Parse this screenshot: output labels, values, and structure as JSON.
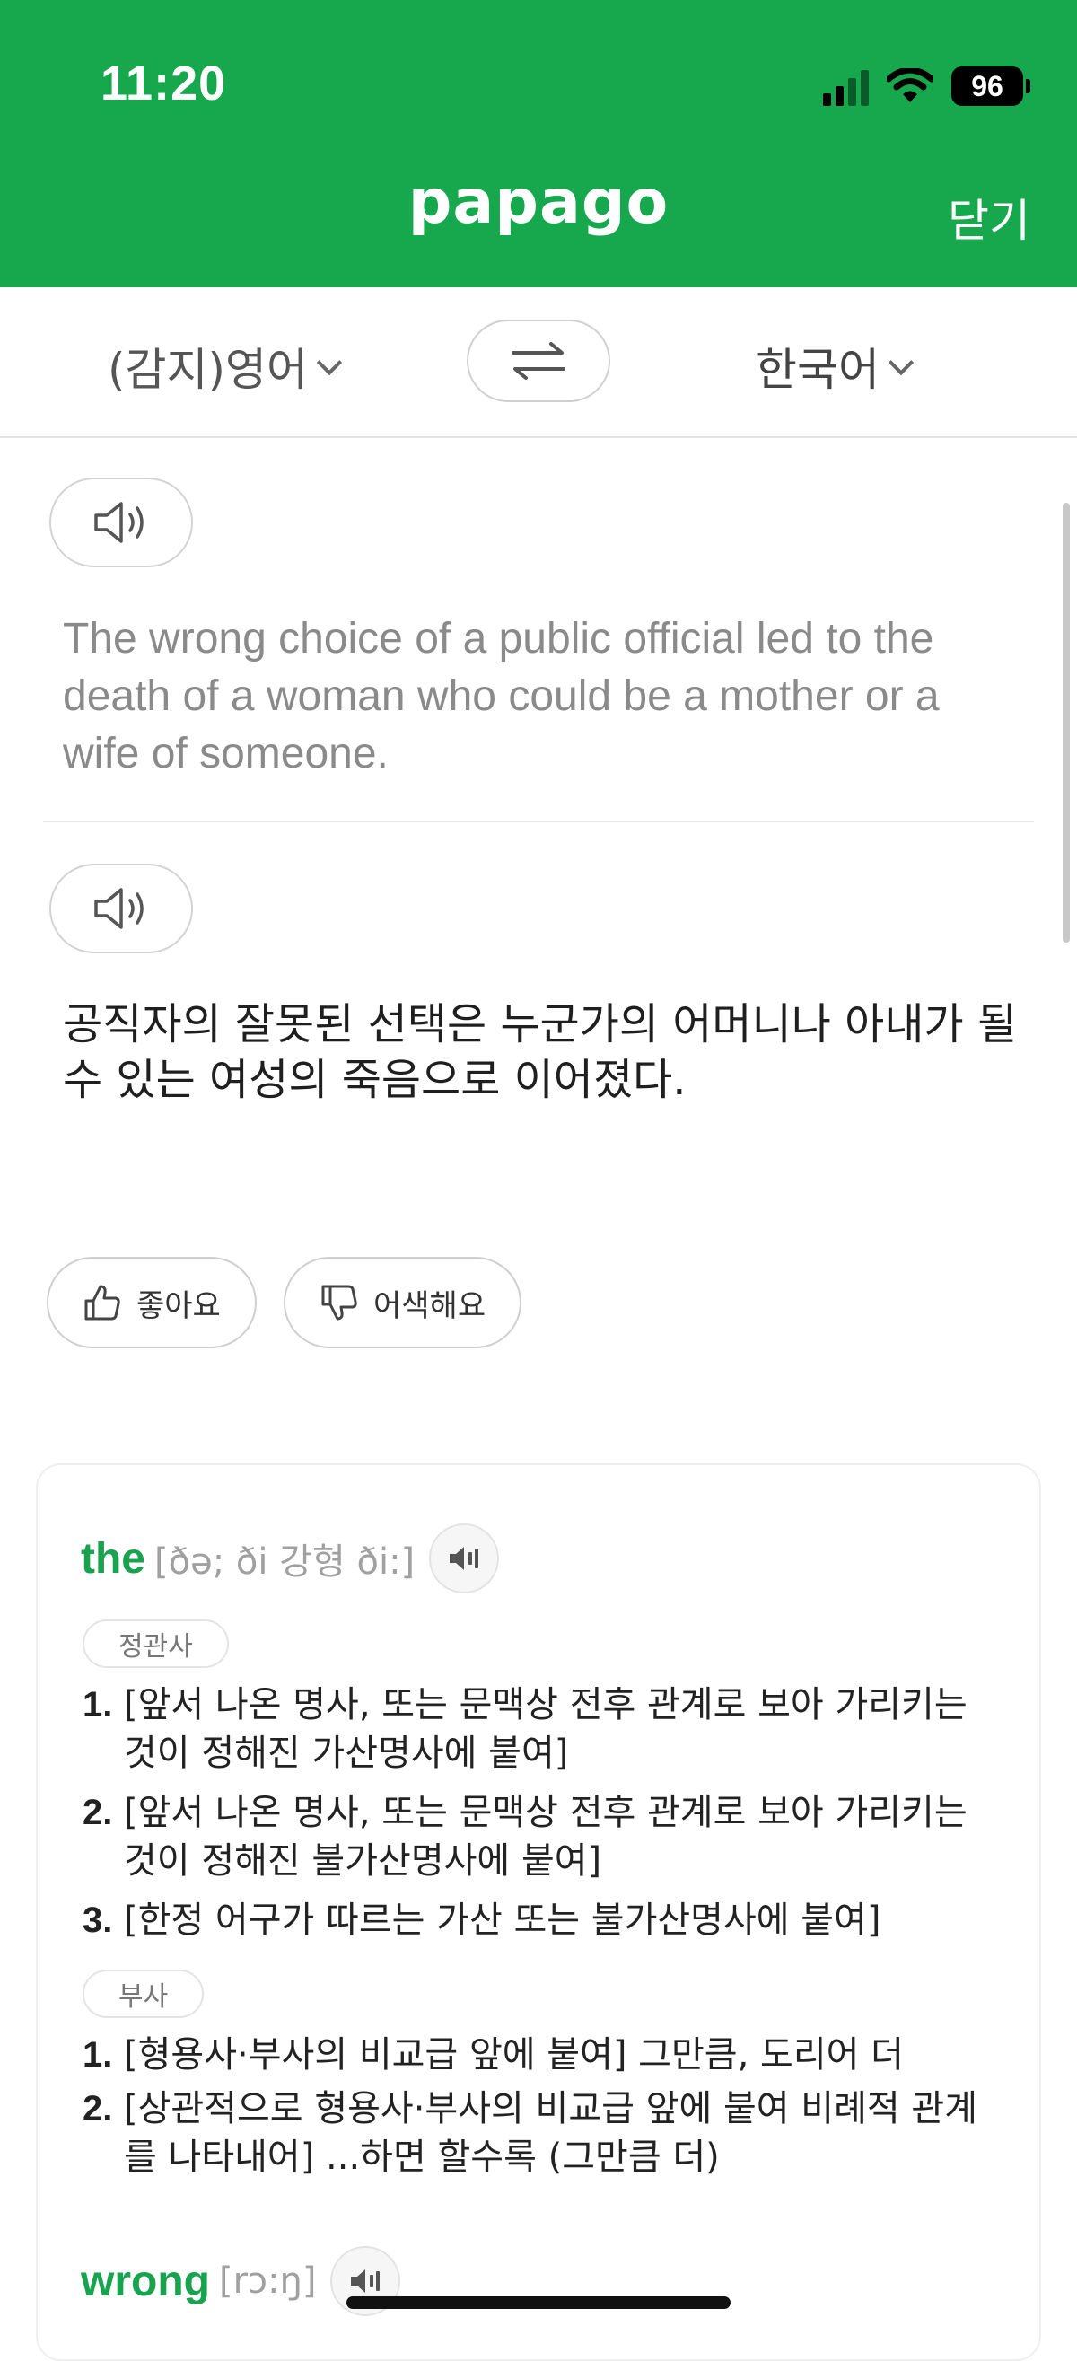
{
  "status_bar": {
    "time": "11:20",
    "battery": "96"
  },
  "header": {
    "title": "papago",
    "close_label": "닫기"
  },
  "languages": {
    "source": "(감지)영어",
    "target": "한국어"
  },
  "icons": {
    "speaker": "speaker-icon",
    "swap": "swap-arrows-icon",
    "thumbs_up": "thumbs-up-icon",
    "thumbs_down": "thumbs-down-icon"
  },
  "translation": {
    "source_text": "The wrong choice of a public official led to the death of a woman who could be a mother or a wife of someone.",
    "target_text": "공직자의 잘못된 선택은 누군가의 어머니나 아내가 될 수 있는 여성의 죽음으로 이어졌다."
  },
  "feedback": {
    "like": "좋아요",
    "dislike": "어색해요"
  },
  "dictionary": {
    "entries": [
      {
        "word": "the",
        "phonetic": "[ðə; ði 강형 ði:]",
        "senses": [
          {
            "pos": "정관사",
            "definitions": [
              {
                "num": "1.",
                "text": "[앞서 나온 명사, 또는 문맥상 전후 관계로 보아 가리키는 것이 정해진 가산명사에 붙여]"
              },
              {
                "num": "2.",
                "text": "[앞서 나온 명사, 또는 문맥상 전후 관계로 보아 가리키는 것이 정해진 불가산명사에 붙여]"
              },
              {
                "num": "3.",
                "text": "[한정 어구가 따르는 가산 또는 불가산명사에 붙여]"
              }
            ]
          },
          {
            "pos": "부사",
            "definitions": [
              {
                "num": "1.",
                "text": "[형용사·부사의 비교급 앞에 붙여] 그만큼, 도리어 더"
              },
              {
                "num": "2.",
                "text": "[상관적으로 형용사·부사의 비교급 앞에 붙여 비례적 관계를 나타내어] ...하면 할수록 (그만큼 더)"
              }
            ]
          }
        ]
      },
      {
        "word": "wrong",
        "phonetic": "[rɔ:ŋ]"
      }
    ]
  },
  "colors": {
    "brand_green": "#17a84e",
    "word_green": "#1aa34f"
  }
}
